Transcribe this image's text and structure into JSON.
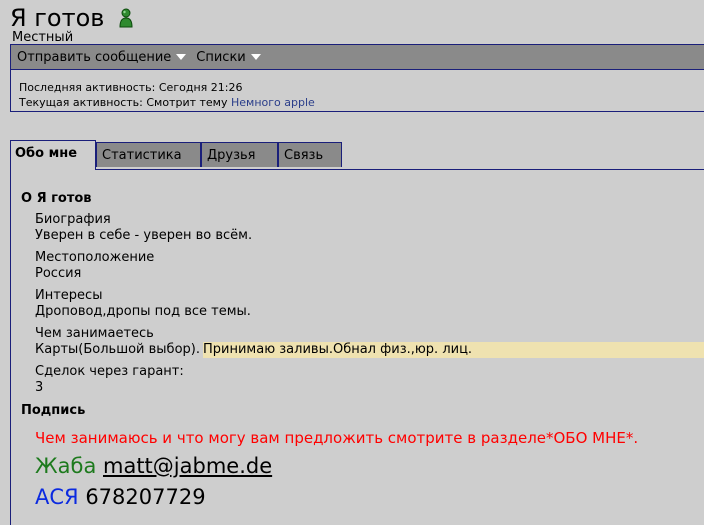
{
  "header": {
    "username": "Я готов",
    "usertitle": "Местный"
  },
  "toolbar": {
    "send_message": "Отправить сообщение",
    "lists": "Списки"
  },
  "activity": {
    "last_label": "Последняя активность:",
    "last_value": "Сегодня 21:26",
    "current_label": "Текущая активность: Смотрит тему",
    "current_link": "Немного apple"
  },
  "tabs": [
    {
      "label": "Обо мне",
      "active": true
    },
    {
      "label": "Статистика",
      "active": false
    },
    {
      "label": "Друзья",
      "active": false
    },
    {
      "label": "Связь",
      "active": false
    }
  ],
  "about": {
    "title": "О Я готов",
    "fields": [
      {
        "label": "Биография",
        "value": "Уверен в себе - уверен во всём."
      },
      {
        "label": "Местоположение",
        "value": "Россия"
      },
      {
        "label": "Интересы",
        "value": "Дроповод,дропы под все темы."
      },
      {
        "label": "Чем занимаетесь",
        "value_plain": "Карты(Большой выбор).",
        "value_highlight": "Принимаю заливы.Обнал физ.,юр. лиц."
      },
      {
        "label": "Сделок через гарант:",
        "value": "3"
      }
    ]
  },
  "signature": {
    "title": "Подпись",
    "line1": "Чем занимаюсь и что могу вам предложить смотрите в разделе*ОБО МНЕ*.",
    "jabber_label": "Жаба",
    "jabber_value": "matt@jabme.de",
    "icq_label": "АСЯ",
    "icq_value": "678207729"
  },
  "colors": {
    "background": "#cecece",
    "bar": "#8a8a8a",
    "border": "#1a1f7a",
    "highlight": "#efe2b0",
    "signature_red": "#ff0000",
    "jabber_green": "#1d7a1d",
    "icq_blue": "#0b2ae0"
  }
}
